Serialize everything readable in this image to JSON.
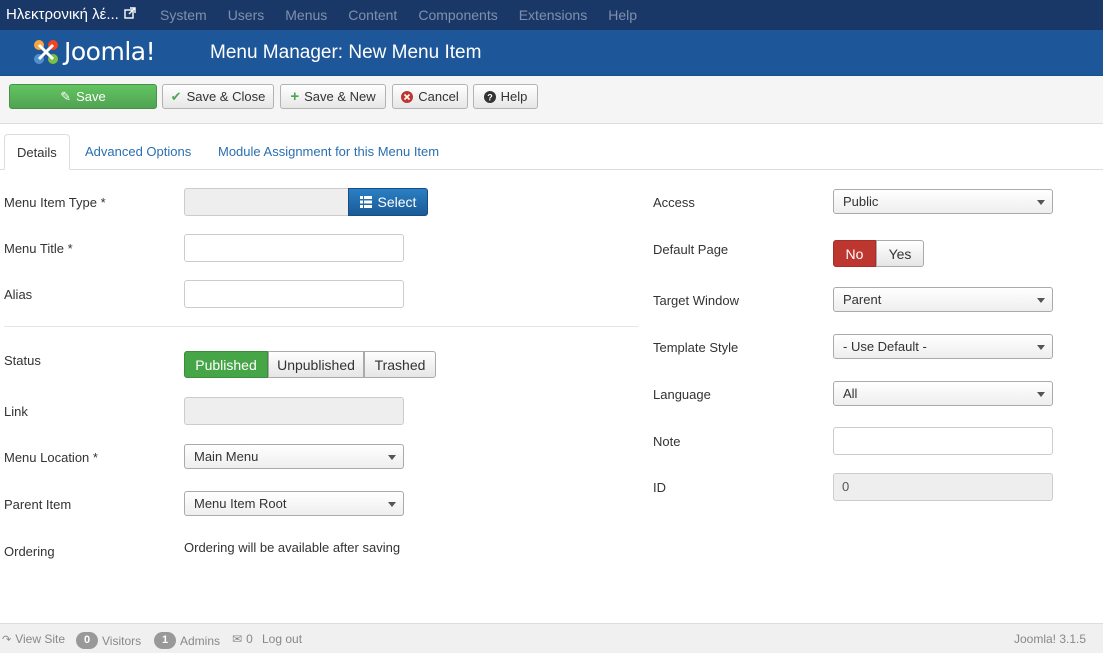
{
  "topbar": {
    "site_name": "Ηλεκτρονική λέ...",
    "nav": [
      "System",
      "Users",
      "Menus",
      "Content",
      "Components",
      "Extensions",
      "Help"
    ]
  },
  "header": {
    "logo_text": "Joomla!",
    "title": "Menu Manager: New Menu Item"
  },
  "toolbar": {
    "save": "Save",
    "save_close": "Save & Close",
    "save_new": "Save & New",
    "cancel": "Cancel",
    "help": "Help"
  },
  "tabs": [
    "Details",
    "Advanced Options",
    "Module Assignment for this Menu Item"
  ],
  "left": {
    "menu_item_type_label": "Menu Item Type *",
    "select_button": "Select",
    "menu_title_label": "Menu Title *",
    "alias_label": "Alias",
    "status_label": "Status",
    "status_options": [
      "Published",
      "Unpublished",
      "Trashed"
    ],
    "link_label": "Link",
    "menu_location_label": "Menu Location *",
    "menu_location_value": "Main Menu",
    "parent_item_label": "Parent Item",
    "parent_item_value": "Menu Item Root",
    "ordering_label": "Ordering",
    "ordering_text": "Ordering will be available after saving"
  },
  "right": {
    "access_label": "Access",
    "access_value": "Public",
    "default_page_label": "Default Page",
    "default_page_options": [
      "No",
      "Yes"
    ],
    "target_window_label": "Target Window",
    "target_window_value": "Parent",
    "template_style_label": "Template Style",
    "template_style_value": "- Use Default -",
    "language_label": "Language",
    "language_value": "All",
    "note_label": "Note",
    "id_label": "ID",
    "id_value": "0"
  },
  "footer": {
    "view_site": "View Site",
    "visitors_count": "0",
    "visitors": "Visitors",
    "admins_count": "1",
    "admins": "Admins",
    "messages_count": "0",
    "logout": "Log out",
    "version": "Joomla! 3.1.5"
  },
  "colors": {
    "topbar": "#1a3867",
    "header": "#1e5799",
    "save_green": "#51a351",
    "published_green": "#46a546",
    "no_red": "#bd362f",
    "select_blue": "#1b5a96"
  }
}
